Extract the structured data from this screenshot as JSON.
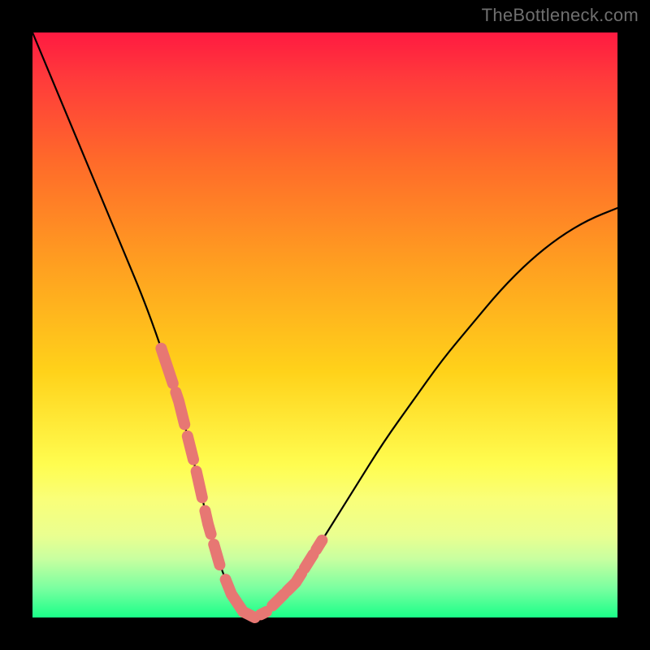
{
  "watermark": "TheBottleneck.com",
  "colors": {
    "background": "#000000",
    "gradient_top": "#ff1a41",
    "gradient_bottom": "#1aff88",
    "curve": "#000000",
    "blob": "#e77773",
    "watermark": "#6f6f6f"
  },
  "chart_data": {
    "type": "line",
    "title": "",
    "xlabel": "",
    "ylabel": "",
    "xlim": [
      0,
      100
    ],
    "ylim": [
      0,
      100
    ],
    "grid": false,
    "legend": false,
    "annotations": [
      "TheBottleneck.com"
    ],
    "series": [
      {
        "name": "bottleneck-curve",
        "x": [
          0,
          5,
          10,
          15,
          20,
          25,
          28,
          30,
          32,
          34,
          36,
          38,
          40,
          45,
          50,
          55,
          60,
          65,
          70,
          75,
          80,
          85,
          90,
          95,
          100
        ],
        "y": [
          100,
          88,
          76,
          64,
          52,
          37,
          25,
          16,
          9,
          4,
          1,
          0,
          1,
          6,
          14,
          22,
          30,
          37,
          44,
          50,
          56,
          61,
          65,
          68,
          70
        ]
      }
    ],
    "highlight_segments": {
      "name": "blobs",
      "description": "short pinkish segments overlaid on curve near the valley on both arms",
      "x_ranges": [
        [
          22,
          24
        ],
        [
          24.5,
          26
        ],
        [
          26.5,
          27.5
        ],
        [
          28,
          29
        ],
        [
          29.5,
          30.5
        ],
        [
          31,
          32
        ],
        [
          33,
          38
        ],
        [
          39,
          40
        ],
        [
          41,
          43
        ],
        [
          43.5,
          46
        ],
        [
          46.5,
          48
        ],
        [
          48.5,
          49.5
        ]
      ]
    }
  }
}
